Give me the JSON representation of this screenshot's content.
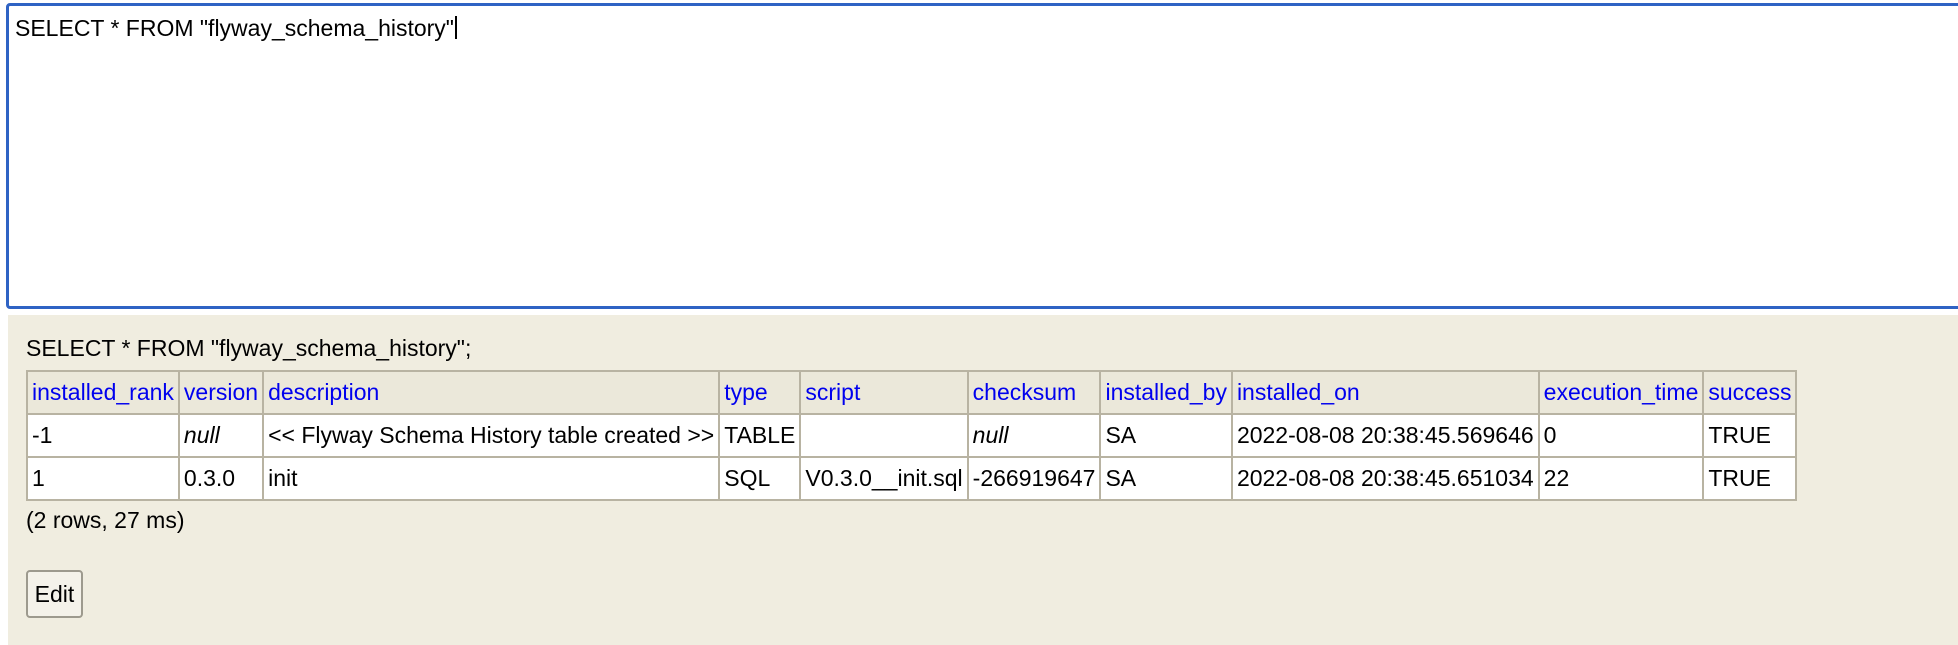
{
  "editor": {
    "sql": "SELECT * FROM \"flyway_schema_history\""
  },
  "results": {
    "query": "SELECT * FROM \"flyway_schema_history\";",
    "columns": [
      "installed_rank",
      "version",
      "description",
      "type",
      "script",
      "checksum",
      "installed_by",
      "installed_on",
      "execution_time",
      "success"
    ],
    "rows": [
      [
        "-1",
        "null",
        "<< Flyway Schema History table created >>",
        "TABLE",
        "",
        "null",
        "SA",
        "2022-08-08 20:38:45.569646",
        "0",
        "TRUE"
      ],
      [
        "1",
        "0.3.0",
        "init",
        "SQL",
        "V0.3.0__init.sql",
        "-266919647",
        "SA",
        "2022-08-08 20:38:45.651034",
        "22",
        "TRUE"
      ]
    ],
    "summary": "(2 rows, 27 ms)",
    "edit_label": "Edit"
  }
}
